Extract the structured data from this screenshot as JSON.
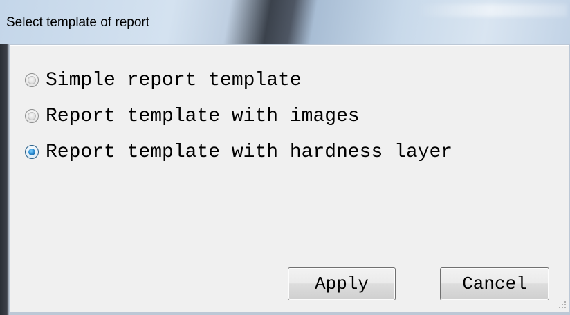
{
  "window": {
    "title": "Select template of report"
  },
  "options": [
    {
      "label": "Simple report template",
      "checked": false
    },
    {
      "label": "Report template with images",
      "checked": false
    },
    {
      "label": "Report template with hardness layer",
      "checked": true
    }
  ],
  "buttons": {
    "apply_label": "Apply",
    "cancel_label": "Cancel"
  },
  "colors": {
    "dialog_background": "#f0f0f0",
    "radio_selected": "#2d8fd4"
  },
  "icons": {
    "resize": "resize-grip-icon"
  }
}
